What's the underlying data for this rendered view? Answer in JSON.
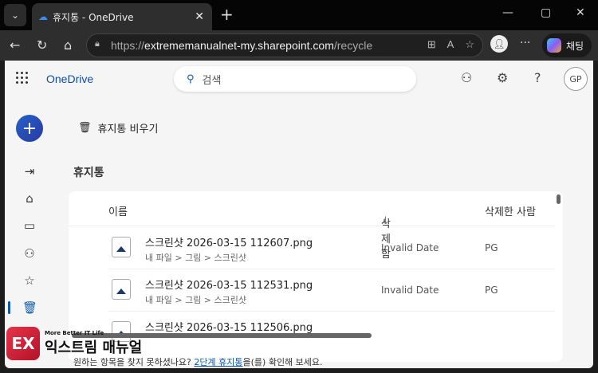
{
  "browser": {
    "tab_title": "휴지통 - OneDrive",
    "url_prefix": "https://",
    "url_host": "extrememanualnet-my.sharepoint.com",
    "url_path": "/recycle",
    "copilot_label": "채팅"
  },
  "header": {
    "brand": "OneDrive",
    "search_placeholder": "검색",
    "avatar_initials": "GP"
  },
  "toolbar": {
    "empty_recycle_label": "휴지통 비우기"
  },
  "main": {
    "title": "휴지통",
    "columns": {
      "name": "이름",
      "deleted": "삭제함",
      "sort_indicator": "↓",
      "deleted_by": "삭제한 사람"
    },
    "rows": [
      {
        "name": "스크린샷 2026-03-15 112607.png",
        "path": "내 파일 > 그림 > 스크린샷",
        "deleted": "Invalid Date",
        "deleted_by": "PG"
      },
      {
        "name": "스크린샷 2026-03-15 112531.png",
        "path": "내 파일 > 그림 > 스크린샷",
        "deleted": "Invalid Date",
        "deleted_by": "PG"
      },
      {
        "name": "스크린샷 2026-03-15 112506.png",
        "path": "",
        "deleted": "",
        "deleted_by": ""
      }
    ],
    "footer_prefix": "원하는 항목을 찾지 못하셨나요?",
    "footer_link": "2단계 휴지통",
    "footer_suffix": "을(를) 확인해 보세요."
  },
  "watermark": {
    "tagline": "More Better IT Life",
    "name": "익스트림 매뉴얼"
  },
  "colors": {
    "accent": "#0f5aa8",
    "brand": "#0f4c9c"
  }
}
